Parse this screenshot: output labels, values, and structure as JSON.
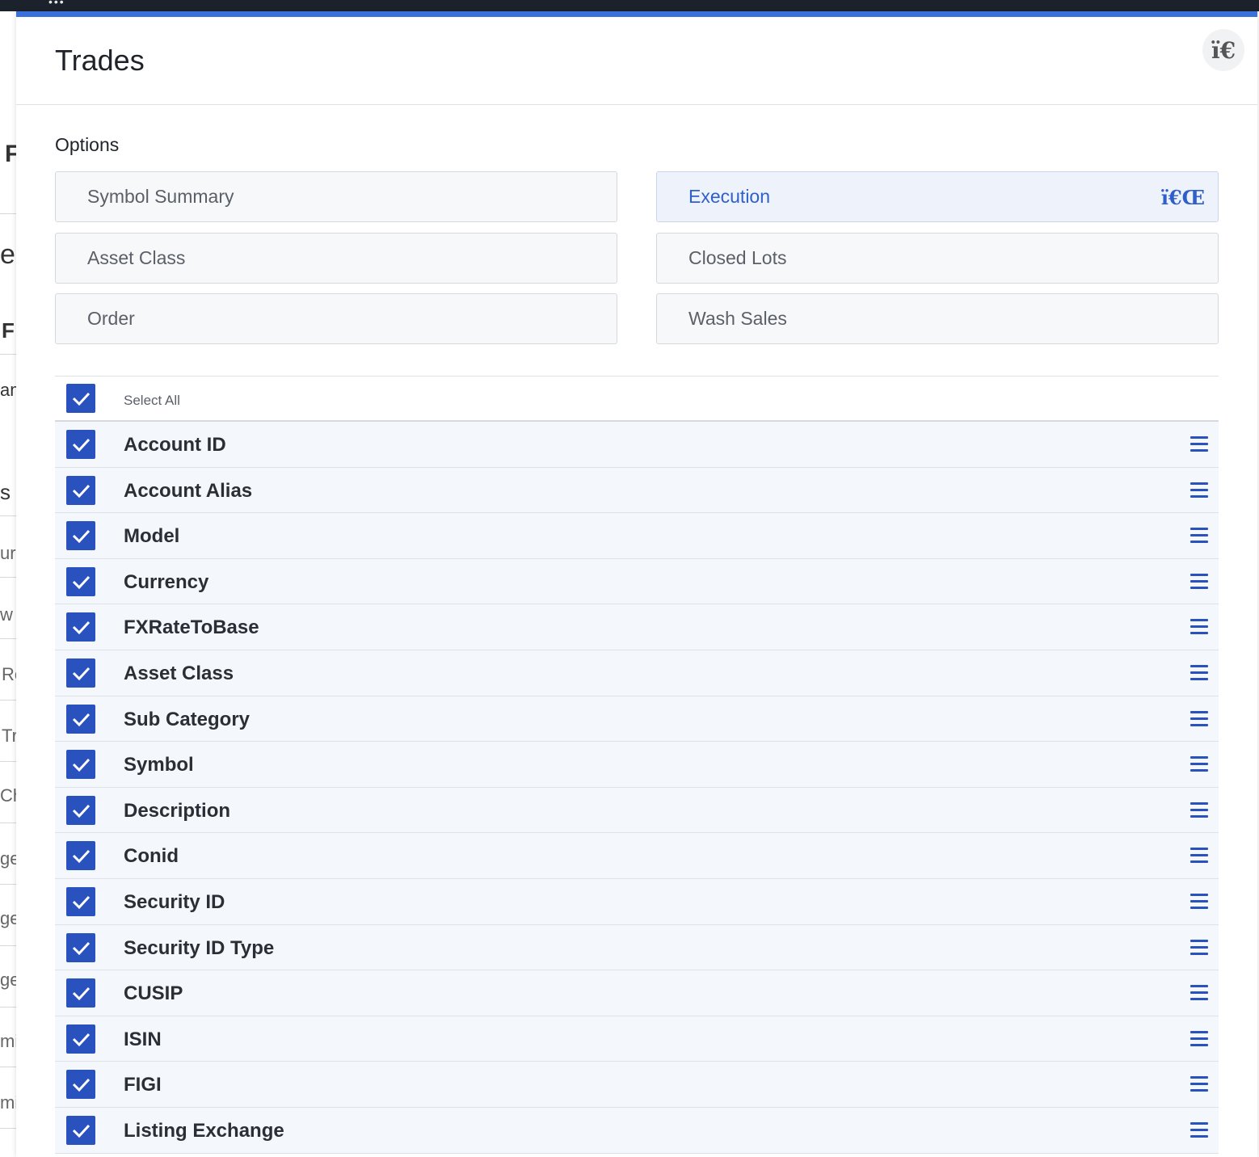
{
  "background_fragments": [
    "F",
    "e",
    "F",
    "am",
    "s",
    "ur",
    "w",
    "Re",
    "Tr",
    "Ch",
    "ge",
    "ge",
    "ge",
    "mi",
    "mi"
  ],
  "modal": {
    "title": "Trades",
    "close_icon_glyph": "ï€"
  },
  "options": {
    "label": "Options",
    "buttons": [
      {
        "label": "Symbol Summary",
        "active": false
      },
      {
        "label": "Execution",
        "active": true,
        "icon_glyph": "ï€Œ"
      },
      {
        "label": "Asset Class",
        "active": false
      },
      {
        "label": "Closed Lots",
        "active": false
      },
      {
        "label": "Order",
        "active": false
      },
      {
        "label": "Wash Sales",
        "active": false
      }
    ]
  },
  "columns": {
    "select_all_label": "Select All",
    "items": [
      {
        "label": "Account ID",
        "checked": true
      },
      {
        "label": "Account Alias",
        "checked": true
      },
      {
        "label": "Model",
        "checked": true
      },
      {
        "label": "Currency",
        "checked": true
      },
      {
        "label": "FXRateToBase",
        "checked": true
      },
      {
        "label": "Asset Class",
        "checked": true
      },
      {
        "label": "Sub Category",
        "checked": true
      },
      {
        "label": "Symbol",
        "checked": true
      },
      {
        "label": "Description",
        "checked": true
      },
      {
        "label": "Conid",
        "checked": true
      },
      {
        "label": "Security ID",
        "checked": true
      },
      {
        "label": "Security ID Type",
        "checked": true
      },
      {
        "label": "CUSIP",
        "checked": true
      },
      {
        "label": "ISIN",
        "checked": true
      },
      {
        "label": "FIGI",
        "checked": true
      },
      {
        "label": "Listing Exchange",
        "checked": true
      }
    ]
  },
  "colors": {
    "accent": "#2a52be",
    "header_bar": "#3b6fdc",
    "row_bg": "#f4f7fc"
  }
}
